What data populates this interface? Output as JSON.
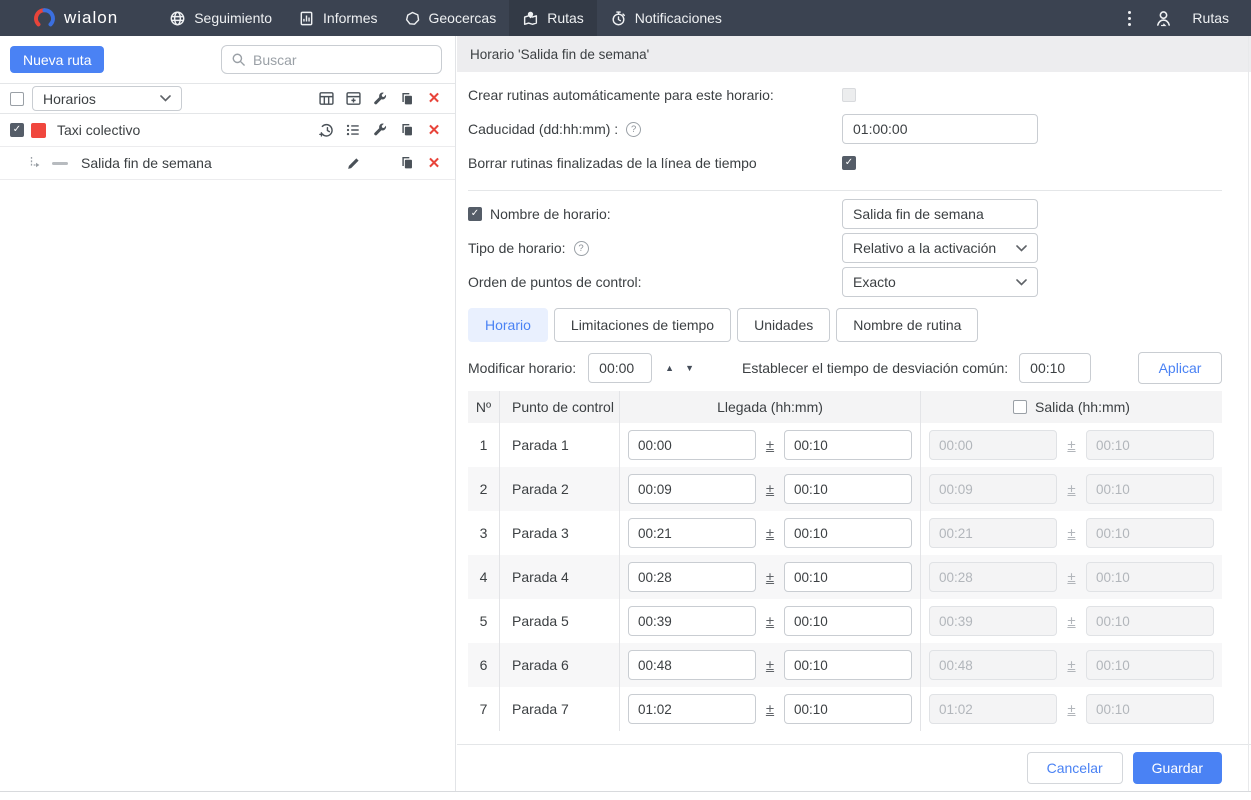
{
  "colors": {
    "topbar_bg": "#3b4351",
    "topbar_active_bg": "#333a46",
    "accent_blue": "#4a82f4",
    "delete_red": "#e8443a",
    "route_swatch_red": "#f0473e",
    "tab_active_bg": "#e9f0fe",
    "panel_header_bg": "#ededef",
    "table_head_bg": "#f4f4f5"
  },
  "topbar": {
    "logo_text": "wialon",
    "nav": [
      {
        "label": "Seguimiento",
        "icon": "globe-icon",
        "active": false
      },
      {
        "label": "Informes",
        "icon": "report-icon",
        "active": false
      },
      {
        "label": "Geocercas",
        "icon": "geofence-icon",
        "active": false
      },
      {
        "label": "Rutas",
        "icon": "routes-icon",
        "active": true
      },
      {
        "label": "Notificaciones",
        "icon": "stopwatch-icon",
        "active": false
      }
    ],
    "overflow_icon": "kebab-menu-icon",
    "user_icon": "user-icon",
    "user_section_label": "Rutas"
  },
  "sidebar": {
    "new_route_button": "Nueva ruta",
    "search_placeholder": "Buscar",
    "filter": {
      "checked": false,
      "label": "Horarios",
      "actions": [
        "table-icon",
        "table-add-icon",
        "wrench-icon",
        "copy-icon",
        "delete-icon"
      ]
    },
    "tree": [
      {
        "name": "Taxi colectivo",
        "checked": true,
        "color": "#f0473e",
        "actions": [
          "history-add-icon",
          "list-icon",
          "wrench-icon",
          "copy-icon",
          "delete-icon"
        ]
      },
      {
        "name": "Salida fin de semana",
        "color": "#b7bbbf",
        "actions": [
          "edit-icon",
          "copy-icon",
          "delete-icon"
        ]
      }
    ]
  },
  "panel": {
    "title": "Horario 'Salida fin de semana'",
    "form": {
      "auto_routines_label": "Crear rutinas automáticamente para este horario:",
      "auto_routines_checked": false,
      "expiration_label": "Caducidad (dd:hh:mm)  :",
      "expiration_value": "01:00:00",
      "remove_finished_label": "Borrar rutinas finalizadas de la línea de tiempo",
      "remove_finished_checked": true,
      "name_label": "Nombre de horario:",
      "name_checked": true,
      "name_value": "Salida fin de semana",
      "type_label": "Tipo de horario:",
      "type_value": "Relativo a la activación",
      "order_label": "Orden de puntos de control:",
      "order_value": "Exacto"
    },
    "tabs": [
      {
        "label": "Horario",
        "active": true
      },
      {
        "label": "Limitaciones de tiempo",
        "active": false
      },
      {
        "label": "Unidades",
        "active": false
      },
      {
        "label": "Nombre de rutina",
        "active": false
      }
    ],
    "modify": {
      "label": "Modificar horario:",
      "value": "00:00",
      "deviation_label": "Establecer el tiempo de desviación común:",
      "deviation_value": "00:10",
      "apply_button": "Aplicar"
    },
    "table": {
      "plus_minus": "±",
      "headers": {
        "num": "Nº",
        "checkpoint": "Punto de control",
        "arrival": "Llegada (hh:mm)",
        "departure": "Salida (hh:mm)"
      },
      "departure_checked": false,
      "rows": [
        {
          "num": "1",
          "name": "Parada 1",
          "arrival": "00:00",
          "arrival_dev": "00:10",
          "departure": "00:00",
          "departure_dev": "00:10"
        },
        {
          "num": "2",
          "name": "Parada 2",
          "arrival": "00:09",
          "arrival_dev": "00:10",
          "departure": "00:09",
          "departure_dev": "00:10"
        },
        {
          "num": "3",
          "name": "Parada 3",
          "arrival": "00:21",
          "arrival_dev": "00:10",
          "departure": "00:21",
          "departure_dev": "00:10"
        },
        {
          "num": "4",
          "name": "Parada 4",
          "arrival": "00:28",
          "arrival_dev": "00:10",
          "departure": "00:28",
          "departure_dev": "00:10"
        },
        {
          "num": "5",
          "name": "Parada 5",
          "arrival": "00:39",
          "arrival_dev": "00:10",
          "departure": "00:39",
          "departure_dev": "00:10"
        },
        {
          "num": "6",
          "name": "Parada 6",
          "arrival": "00:48",
          "arrival_dev": "00:10",
          "departure": "00:48",
          "departure_dev": "00:10"
        },
        {
          "num": "7",
          "name": "Parada 7",
          "arrival": "01:02",
          "arrival_dev": "00:10",
          "departure": "01:02",
          "departure_dev": "00:10"
        }
      ]
    },
    "footer": {
      "cancel_button": "Cancelar",
      "save_button": "Guardar"
    }
  }
}
